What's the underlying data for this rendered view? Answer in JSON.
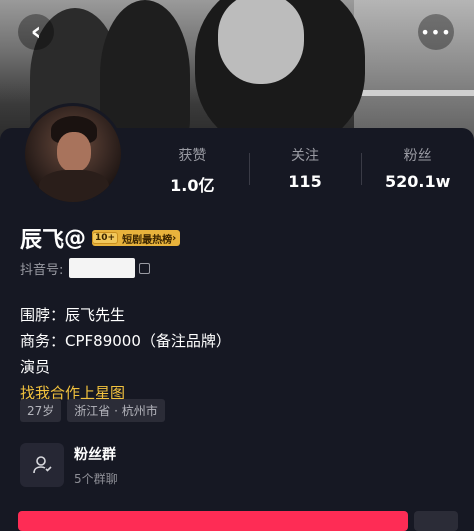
{
  "header": {
    "back_icon": "chevron-left-icon",
    "more_icon": "more-dots-icon"
  },
  "stats": [
    {
      "label": "获赞",
      "value": "1.0亿"
    },
    {
      "label": "关注",
      "value": "115"
    },
    {
      "label": "粉丝",
      "value": "520.1w"
    }
  ],
  "profile": {
    "name": "辰飞",
    "at_symbol": "@",
    "rank_badge_num": "10+",
    "rank_badge_text": "短剧最热榜",
    "douyin_id_label": "抖音号:"
  },
  "bio": {
    "line1": "围脖：辰飞先生",
    "line2": "商务：CPF89000（备注品牌）",
    "line3": "演员",
    "link": "找我合作上星图"
  },
  "tags": [
    "27岁",
    "浙江省 · 杭州市"
  ],
  "fan_group": {
    "title": "粉丝群",
    "subtitle": "5个群聊"
  },
  "colors": {
    "background": "#161823",
    "accent": "#fe2c55",
    "link": "#f2c23e",
    "badge": "#e8b33c"
  }
}
